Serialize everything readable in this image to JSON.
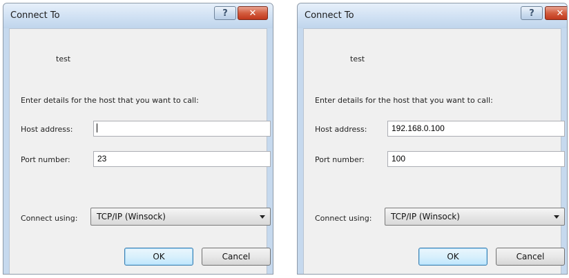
{
  "dialogs": [
    {
      "title": "Connect To",
      "help_glyph": "?",
      "close_glyph": "✕",
      "connection_name": "test",
      "instructions": "Enter details for the host that you want to call:",
      "host_label": "Host address:",
      "host_value": "",
      "port_label": "Port number:",
      "port_value": "23",
      "connect_label": "Connect using:",
      "connect_value": "TCP/IP (Winsock)",
      "ok_label": "OK",
      "cancel_label": "Cancel"
    },
    {
      "title": "Connect To",
      "help_glyph": "?",
      "close_glyph": "✕",
      "connection_name": "test",
      "instructions": "Enter details for the host that you want to call:",
      "host_label": "Host address:",
      "host_value": "192.168.0.100",
      "port_label": "Port number:",
      "port_value": "100",
      "connect_label": "Connect using:",
      "connect_value": "TCP/IP (Winsock)",
      "ok_label": "OK",
      "cancel_label": "Cancel"
    }
  ]
}
